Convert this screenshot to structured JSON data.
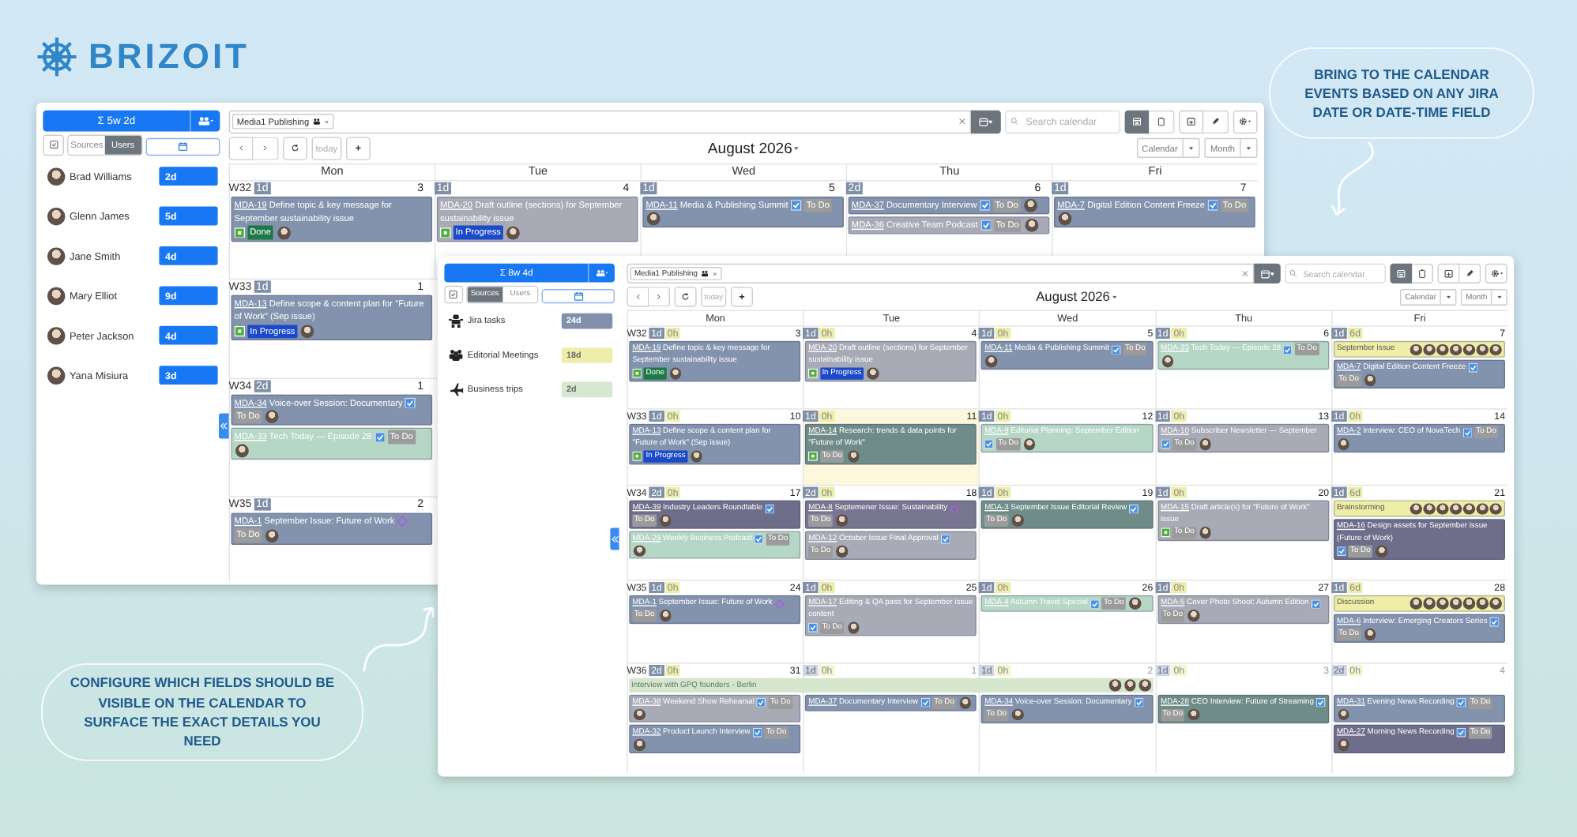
{
  "logo": {
    "name": "BRIZOIT"
  },
  "callouts": [
    {
      "kind": "top",
      "text": "BRING TO THE CALENDAR EVENTS BASED ON ANY JIRA DATE OR DATE-TIME FIELD"
    },
    {
      "kind": "bottom",
      "text": "CONFIGURE WHICH FIELDS SHOULD BE VISIBLE ON THE CALENDAR TO SURFACE THE EXACT DETAILS YOU NEED"
    }
  ],
  "windows": [
    {
      "kind": "back",
      "summary": "Σ 5w 2d",
      "panel_tabs": [
        {
          "label": "Sources",
          "selected": false
        },
        {
          "label": "Users",
          "selected": true
        }
      ],
      "panel_rows": [
        {
          "kind": "user",
          "name": "Brad Williams",
          "total": "2d"
        },
        {
          "kind": "user",
          "name": "Glenn James",
          "total": "5d"
        },
        {
          "kind": "user",
          "name": "Jane Smith",
          "total": "4d"
        },
        {
          "kind": "user",
          "name": "Mary Elliot",
          "total": "9d"
        },
        {
          "kind": "user",
          "name": "Peter Jackson",
          "total": "4d"
        },
        {
          "kind": "user",
          "name": "Yana Misiura",
          "total": "3d"
        }
      ],
      "filter_chip": "Media1 Publishing",
      "search": {
        "placeholder": "Search calendar"
      },
      "view_toggle": [
        {
          "kind": "calendar",
          "selected": true
        },
        {
          "kind": "list",
          "selected": false
        }
      ],
      "today_button": "today",
      "month": "August 2026",
      "selects": [
        "Calendar",
        "Month"
      ],
      "weekdays": [
        "Mon",
        "Tue",
        "Wed",
        "Thu",
        "Fri"
      ],
      "weeks": [
        {
          "label": "W32",
          "days": [
            {
              "date": "3",
              "jira": "1d",
              "events": [
                {
                  "kind": "story",
                  "key": "MDA-19",
                  "title": "Define topic & key message for September sustainability issue",
                  "status": {
                    "text": "Done",
                    "color": "#1d7a46"
                  },
                  "color": "#8393ad"
                }
              ]
            },
            {
              "date": "4",
              "jira": "1d",
              "events": [
                {
                  "kind": "story",
                  "key": "MDA-20",
                  "title": "Draft outline (sections) for September sustainability issue",
                  "status": {
                    "text": "In Progress",
                    "color": "#1a49c9"
                  },
                  "color": "#a8abb6"
                }
              ]
            },
            {
              "date": "5",
              "jira": "1d",
              "events": [
                {
                  "kind": "task",
                  "key": "MDA-11",
                  "title": "Media & Publishing Summit",
                  "status": {
                    "text": "To Do",
                    "color": "#9b9b9b"
                  },
                  "color": "#8393ad"
                }
              ]
            },
            {
              "date": "6",
              "jira": "2d",
              "events": [
                {
                  "kind": "task",
                  "key": "MDA-37",
                  "title": "Documentary Interview",
                  "status": {
                    "text": "To Do",
                    "color": "#9b9b9b"
                  },
                  "color": "#8393ad"
                },
                {
                  "kind": "task",
                  "key": "MDA-36",
                  "title": "Creative Team Podcast",
                  "status": {
                    "text": "To Do",
                    "color": "#9b9b9b"
                  },
                  "color": "#a8abb6"
                }
              ]
            },
            {
              "date": "7",
              "jira": "1d",
              "events": [
                {
                  "kind": "task",
                  "key": "MDA-7",
                  "title": "Digital Edition Content Freeze",
                  "status": {
                    "text": "To Do",
                    "color": "#9b9b9b"
                  },
                  "color": "#8393ad"
                }
              ]
            }
          ]
        },
        {
          "label": "W33",
          "days": [
            {
              "date": "1",
              "jira": "1d",
              "events": [
                {
                  "kind": "story",
                  "key": "MDA-13",
                  "title": "Define scope & content plan for \"Future of Work\" (Sep issue)",
                  "status": {
                    "text": "In Progress",
                    "color": "#1a49c9"
                  },
                  "color": "#8393ad"
                }
              ]
            }
          ]
        },
        {
          "label": "W34",
          "days": [
            {
              "date": "1",
              "jira": "2d",
              "events": [
                {
                  "kind": "task",
                  "key": "MDA-34",
                  "title": "Voice-over Session: Documentary",
                  "status": {
                    "text": "To Do",
                    "color": "#9b9b9b"
                  },
                  "color": "#8393ad"
                },
                {
                  "kind": "task",
                  "key": "MDA-33",
                  "title": "Tech Today — Episode 28",
                  "status": {
                    "text": "To Do",
                    "color": "#9b9b9b"
                  },
                  "color": "#b6d6c6"
                }
              ]
            }
          ]
        },
        {
          "label": "W35",
          "days": [
            {
              "date": "2",
              "jira": "1d",
              "events": [
                {
                  "kind": "epic",
                  "key": "MDA-1",
                  "title": "September Issue: Future of Work",
                  "status": {
                    "text": "To Do",
                    "color": "#9b9b9b"
                  },
                  "color": "#8393ad"
                }
              ]
            }
          ]
        }
      ]
    },
    {
      "kind": "front",
      "summary": "Σ 8w 4d",
      "panel_tabs": [
        {
          "label": "Sources",
          "selected": true
        },
        {
          "label": "Users",
          "selected": false
        }
      ],
      "panel_rows": [
        {
          "kind": "jira",
          "name": "Jira tasks",
          "total": "24d",
          "color": "#8191ab"
        },
        {
          "kind": "meeting",
          "name": "Editorial Meetings",
          "total": "18d",
          "color": "#eeeeaa"
        },
        {
          "kind": "trip",
          "name": "Business trips",
          "total": "2d",
          "color": "#d6e8cf"
        }
      ],
      "filter_chip": "Media1 Publishing",
      "search": {
        "placeholder": "Search calendar"
      },
      "view_toggle": [
        {
          "kind": "calendar",
          "selected": true
        },
        {
          "kind": "list",
          "selected": false
        }
      ],
      "today_button": "today",
      "month": "August 2026",
      "selects": [
        "Calendar",
        "Month"
      ],
      "weekdays": [
        "Mon",
        "Tue",
        "Wed",
        "Thu",
        "Fri"
      ],
      "weeks": [
        {
          "label": "W32",
          "days": [
            {
              "date": "3",
              "jira": "1d",
              "meet": "0h",
              "today": false,
              "faded": false,
              "events": [
                {
                  "kind": "story",
                  "key": "MDA-19",
                  "title": "Define topic & key message for September sustainability issue",
                  "status": {
                    "text": "Done",
                    "color": "#1d7a46"
                  },
                  "color": "#8393ad"
                }
              ]
            },
            {
              "date": "4",
              "jira": "1d",
              "meet": "0h",
              "today": false,
              "faded": false,
              "events": [
                {
                  "kind": "story",
                  "key": "MDA-20",
                  "title": "Draft outline (sections) for September sustainability issue",
                  "status": {
                    "text": "In Progress",
                    "color": "#1a49c9"
                  },
                  "color": "#a8abb6"
                }
              ]
            },
            {
              "date": "5",
              "jira": "1d",
              "meet": "0h",
              "today": false,
              "faded": false,
              "events": [
                {
                  "kind": "task",
                  "key": "MDA-11",
                  "title": "Media & Publishing Summit",
                  "status": {
                    "text": "To Do",
                    "color": "#9b9b9b"
                  },
                  "color": "#8393ad"
                }
              ]
            },
            {
              "date": "6",
              "jira": "1d",
              "meet": "0h",
              "today": false,
              "faded": false,
              "events": [
                {
                  "kind": "task",
                  "key": "MDA-33",
                  "title": "Tech Today — Episode 28",
                  "status": {
                    "text": "To Do",
                    "color": "#9b9b9b"
                  },
                  "color": "#b6d6c6"
                }
              ]
            },
            {
              "date": "7",
              "jira": "1d",
              "meet": "6d",
              "today": false,
              "faded": false,
              "events": [
                {
                  "kind": "meeting",
                  "title": "September issue",
                  "color": "#eeeea6"
                },
                {
                  "kind": "task",
                  "key": "MDA-7",
                  "title": "Digital Edition Content Freeze",
                  "status": {
                    "text": "To Do",
                    "color": "#9b9b9b"
                  },
                  "color": "#8393ad"
                }
              ]
            }
          ]
        },
        {
          "label": "W33",
          "days": [
            {
              "date": "10",
              "jira": "1d",
              "meet": "0h",
              "today": false,
              "faded": false,
              "events": [
                {
                  "kind": "story",
                  "key": "MDA-13",
                  "title": "Define scope & content plan for \"Future of Work\" (Sep issue)",
                  "status": {
                    "text": "In Progress",
                    "color": "#1a49c9"
                  },
                  "color": "#8393ad"
                }
              ]
            },
            {
              "date": "11",
              "jira": "1d",
              "meet": "0h",
              "today": true,
              "faded": false,
              "events": [
                {
                  "kind": "story",
                  "key": "MDA-14",
                  "title": "Research: trends & data points for \"Future of Work\"",
                  "status": {
                    "text": "To Do",
                    "color": "#9b9b9b"
                  },
                  "color": "#6f8c88"
                }
              ]
            },
            {
              "date": "12",
              "jira": "1d",
              "meet": "0h",
              "today": false,
              "faded": false,
              "events": [
                {
                  "kind": "task",
                  "key": "MDA-9",
                  "title": "Editorial Planning: September Edition",
                  "status": {
                    "text": "To Do",
                    "color": "#9b9b9b"
                  },
                  "color": "#b6d6c6"
                }
              ]
            },
            {
              "date": "13",
              "jira": "1d",
              "meet": "0h",
              "today": false,
              "faded": false,
              "events": [
                {
                  "kind": "task",
                  "key": "MDA-10",
                  "title": "Subscriber Newsletter — September",
                  "status": {
                    "text": "To Do",
                    "color": "#9b9b9b"
                  },
                  "color": "#a8abb6"
                }
              ]
            },
            {
              "date": "14",
              "jira": "1d",
              "meet": "0h",
              "today": false,
              "faded": false,
              "events": [
                {
                  "kind": "task",
                  "key": "MDA-2",
                  "title": "Interview: CEO of NovaTech",
                  "status": {
                    "text": "To Do",
                    "color": "#9b9b9b"
                  },
                  "color": "#8393ad"
                }
              ]
            }
          ]
        },
        {
          "label": "W34",
          "days": [
            {
              "date": "17",
              "jira": "2d",
              "meet": "0h",
              "today": false,
              "faded": false,
              "events": [
                {
                  "kind": "task",
                  "key": "MDA-39",
                  "title": "Industry Leaders Roundtable",
                  "status": {
                    "text": "To Do",
                    "color": "#9b9b9b"
                  },
                  "color": "#6e6d8a"
                },
                {
                  "kind": "task",
                  "key": "MDA-29",
                  "title": "Weekly Business Podcast",
                  "status": {
                    "text": "To Do",
                    "color": "#9b9b9b"
                  },
                  "color": "#b6d6c6"
                }
              ]
            },
            {
              "date": "18",
              "jira": "2d",
              "meet": "0h",
              "today": false,
              "faded": false,
              "events": [
                {
                  "kind": "epic",
                  "key": "MDA-8",
                  "title": "Septemener Issue: Sustainability",
                  "status": {
                    "text": "To Do",
                    "color": "#9b9b9b"
                  },
                  "color": "#77758f"
                },
                {
                  "kind": "task",
                  "key": "MDA-12",
                  "title": "October Issue Final Approval",
                  "status": {
                    "text": "To Do",
                    "color": "#9b9b9b"
                  },
                  "color": "#a8abb6"
                }
              ]
            },
            {
              "date": "19",
              "jira": "1d",
              "meet": "0h",
              "today": false,
              "faded": false,
              "events": [
                {
                  "kind": "task",
                  "key": "MDA-3",
                  "title": "September Issue Editorial Review",
                  "status": {
                    "text": "To Do",
                    "color": "#9b9b9b"
                  },
                  "color": "#6f8c88"
                }
              ]
            },
            {
              "date": "20",
              "jira": "1d",
              "meet": "0h",
              "today": false,
              "faded": false,
              "events": [
                {
                  "kind": "story",
                  "key": "MDA-15",
                  "title": "Draft article(s) for \"Future of Work\" issue",
                  "status": {
                    "text": "To Do",
                    "color": "#9b9b9b"
                  },
                  "color": "#a8abb6"
                }
              ]
            },
            {
              "date": "21",
              "jira": "1d",
              "meet": "6d",
              "today": false,
              "faded": false,
              "events": [
                {
                  "kind": "meeting",
                  "title": "Brainstorming",
                  "color": "#eeeea6"
                },
                {
                  "kind": "task",
                  "key": "MDA-16",
                  "title": "Design assets for September issue (Future of Work)",
                  "status": {
                    "text": "To Do",
                    "color": "#9b9b9b"
                  },
                  "color": "#6e6d8a"
                }
              ]
            }
          ]
        },
        {
          "label": "W35",
          "days": [
            {
              "date": "24",
              "jira": "1d",
              "meet": "0h",
              "today": false,
              "faded": false,
              "events": [
                {
                  "kind": "epic",
                  "key": "MDA-1",
                  "title": "September Issue: Future of Work",
                  "status": {
                    "text": "To Do",
                    "color": "#9b9b9b"
                  },
                  "color": "#8393ad"
                }
              ]
            },
            {
              "date": "25",
              "jira": "1d",
              "meet": "0h",
              "today": false,
              "faded": false,
              "events": [
                {
                  "kind": "task",
                  "key": "MDA-17",
                  "title": "Editing & QA pass for September issue content",
                  "status": {
                    "text": "To Do",
                    "color": "#9b9b9b"
                  },
                  "color": "#a8abb6"
                }
              ]
            },
            {
              "date": "26",
              "jira": "1d",
              "meet": "0h",
              "today": false,
              "faded": false,
              "events": [
                {
                  "kind": "task",
                  "key": "MDA-4",
                  "title": "Autumn Travel Special",
                  "status": {
                    "text": "To Do",
                    "color": "#9b9b9b"
                  },
                  "color": "#b6d6c6"
                }
              ]
            },
            {
              "date": "27",
              "jira": "1d",
              "meet": "0h",
              "today": false,
              "faded": false,
              "events": [
                {
                  "kind": "task",
                  "key": "MDA-5",
                  "title": "Cover Photo Shoot: Autumn Edition",
                  "status": {
                    "text": "To Do",
                    "color": "#9b9b9b"
                  },
                  "color": "#a8abb6"
                }
              ]
            },
            {
              "date": "28",
              "jira": "1d",
              "meet": "6d",
              "today": false,
              "faded": false,
              "events": [
                {
                  "kind": "meeting",
                  "title": "Discussion",
                  "color": "#eeeea6"
                },
                {
                  "kind": "task",
                  "key": "MDA-6",
                  "title": "Interview: Emerging Creators Series",
                  "status": {
                    "text": "To Do",
                    "color": "#9b9b9b"
                  },
                  "color": "#8393ad"
                }
              ]
            }
          ]
        },
        {
          "label": "W36",
          "bar": {
            "kind": "trip",
            "title": "Interview with GPQ founders - Berlin",
            "color": "#d5e6cc"
          },
          "days": [
            {
              "date": "31",
              "jira": "2d",
              "meet": "0h",
              "today": false,
              "faded": false,
              "in_bar": true,
              "events": [
                {
                  "kind": "task",
                  "key": "MDA-38",
                  "title": "Weekend Show Rehearsal",
                  "status": {
                    "text": "To Do",
                    "color": "#9b9b9b"
                  },
                  "color": "#a8abb6"
                },
                {
                  "kind": "task",
                  "key": "MDA-32",
                  "title": "Product Launch Interview",
                  "status": {
                    "text": "To Do",
                    "color": "#9b9b9b"
                  },
                  "color": "#8393ad"
                }
              ]
            },
            {
              "date": "1",
              "jira": "1d",
              "meet": "0h",
              "today": false,
              "faded": true,
              "in_bar": true,
              "events": [
                {
                  "kind": "task",
                  "key": "MDA-37",
                  "title": "Documentary Interview",
                  "status": {
                    "text": "To Do",
                    "color": "#9b9b9b"
                  },
                  "color": "#8393ad"
                }
              ]
            },
            {
              "date": "2",
              "jira": "1d",
              "meet": "0h",
              "today": false,
              "faded": true,
              "in_bar": true,
              "events": [
                {
                  "kind": "task",
                  "key": "MDA-34",
                  "title": "Voice-over Session: Documentary",
                  "status": {
                    "text": "To Do",
                    "color": "#9b9b9b"
                  },
                  "color": "#8393ad"
                }
              ]
            },
            {
              "date": "3",
              "jira": "1d",
              "meet": "0h",
              "today": false,
              "faded": true,
              "in_bar": false,
              "events": [
                {
                  "kind": "task",
                  "key": "MDA-28",
                  "title": "CEO Interview: Future of Streaming",
                  "status": {
                    "text": "To Do",
                    "color": "#9b9b9b"
                  },
                  "color": "#6f8c88"
                }
              ]
            },
            {
              "date": "4",
              "jira": "2d",
              "meet": "0h",
              "today": false,
              "faded": true,
              "in_bar": false,
              "events": [
                {
                  "kind": "task",
                  "key": "MDA-31",
                  "title": "Evening News Recording",
                  "status": {
                    "text": "To Do",
                    "color": "#9b9b9b"
                  },
                  "color": "#8393ad"
                },
                {
                  "kind": "task",
                  "key": "MDA-27",
                  "title": "Morning News Recording",
                  "status": {
                    "text": "To Do",
                    "color": "#9b9b9b"
                  },
                  "color": "#6e6d8a"
                }
              ]
            }
          ]
        }
      ]
    }
  ]
}
